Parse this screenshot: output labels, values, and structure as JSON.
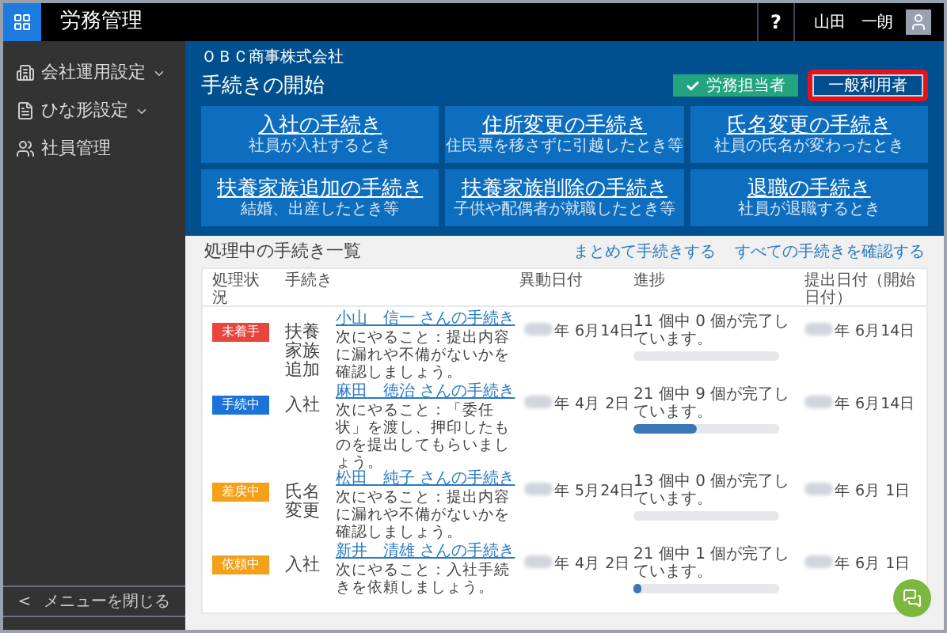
{
  "topbar": {
    "app_title": "労務管理",
    "help": "?",
    "user_name": "山田　一朗"
  },
  "sidebar": {
    "items": [
      {
        "label": "会社運用設定",
        "kind": "building",
        "dropdown": true
      },
      {
        "label": "ひな形設定",
        "kind": "template",
        "dropdown": true
      },
      {
        "label": "社員管理",
        "kind": "people",
        "dropdown": false
      }
    ],
    "collapse": {
      "arrow": "<",
      "label": "メニューを閉じる"
    }
  },
  "company": "ＯＢＣ商事株式会社",
  "start": {
    "title": "手続きの開始",
    "roles": [
      {
        "label": "労務担当者",
        "selected": true,
        "highlighted": false
      },
      {
        "label": "一般利用者",
        "selected": false,
        "highlighted": true
      }
    ],
    "tiles": [
      {
        "title": "入社の手続き",
        "subtitle": "社員が入社するとき"
      },
      {
        "title": "住所変更の手続き",
        "subtitle": "住民票を移さずに引越したとき等"
      },
      {
        "title": "氏名変更の手続き",
        "subtitle": "社員の氏名が変わったとき"
      },
      {
        "title": "扶養家族追加の手続き",
        "subtitle": "結婚、出産したとき等"
      },
      {
        "title": "扶養家族削除の手続き",
        "subtitle": "子供や配偶者が就職したとき等"
      },
      {
        "title": "退職の手続き",
        "subtitle": "社員が退職するとき"
      }
    ]
  },
  "list": {
    "title": "処理中の手続き一覧",
    "actions": [
      "まとめて手続きする",
      "すべての手続きを確認する"
    ],
    "columns": [
      "処理状況",
      "手続き",
      "異動日付",
      "進捗",
      "提出日付（開始日付）"
    ],
    "rows": [
      {
        "status": "未着手",
        "color": "#e8453c",
        "procedure": "扶養家族追加",
        "person": "小山　信一 さんの手続き",
        "next": "次にやること：提出内容に漏れや不備がないかを確認しましょう。",
        "change_date": "年 6月14日",
        "progress": "11 個中 0 個が完了しています。",
        "level": 0,
        "submit_date": "年 6月14日"
      },
      {
        "status": "手続中",
        "color": "#1a73d9",
        "procedure": "入社",
        "person": "麻田　徳治 さんの手続き",
        "next": "次にやること：「委任状」を渡し、押印したものを提出してもらいましょう。",
        "change_date": "年 4月 2日",
        "progress": "21 個中 9 個が完了しています。",
        "level": 0.43,
        "submit_date": "年 6月14日"
      },
      {
        "status": "差戻中",
        "color": "#f5a01a",
        "procedure": "氏名変更",
        "person": "松田　純子 さんの手続き",
        "next": "次にやること：提出内容に漏れや不備がないかを確認しましょう。",
        "change_date": "年 5月24日",
        "progress": "13 個中 0 個が完了しています。",
        "level": 0,
        "submit_date": "年 6月 1日"
      },
      {
        "status": "依頼中",
        "color": "#f5a01b",
        "procedure": "入社",
        "person": "新井　清雄 さんの手続き",
        "next": "次にやること：入社手続きを依頼しましょう。",
        "change_date": "年 4月 2日",
        "progress": "21 個中 1 個が完了しています。",
        "level": 0.05,
        "submit_date": "年 6月 1日"
      }
    ]
  }
}
